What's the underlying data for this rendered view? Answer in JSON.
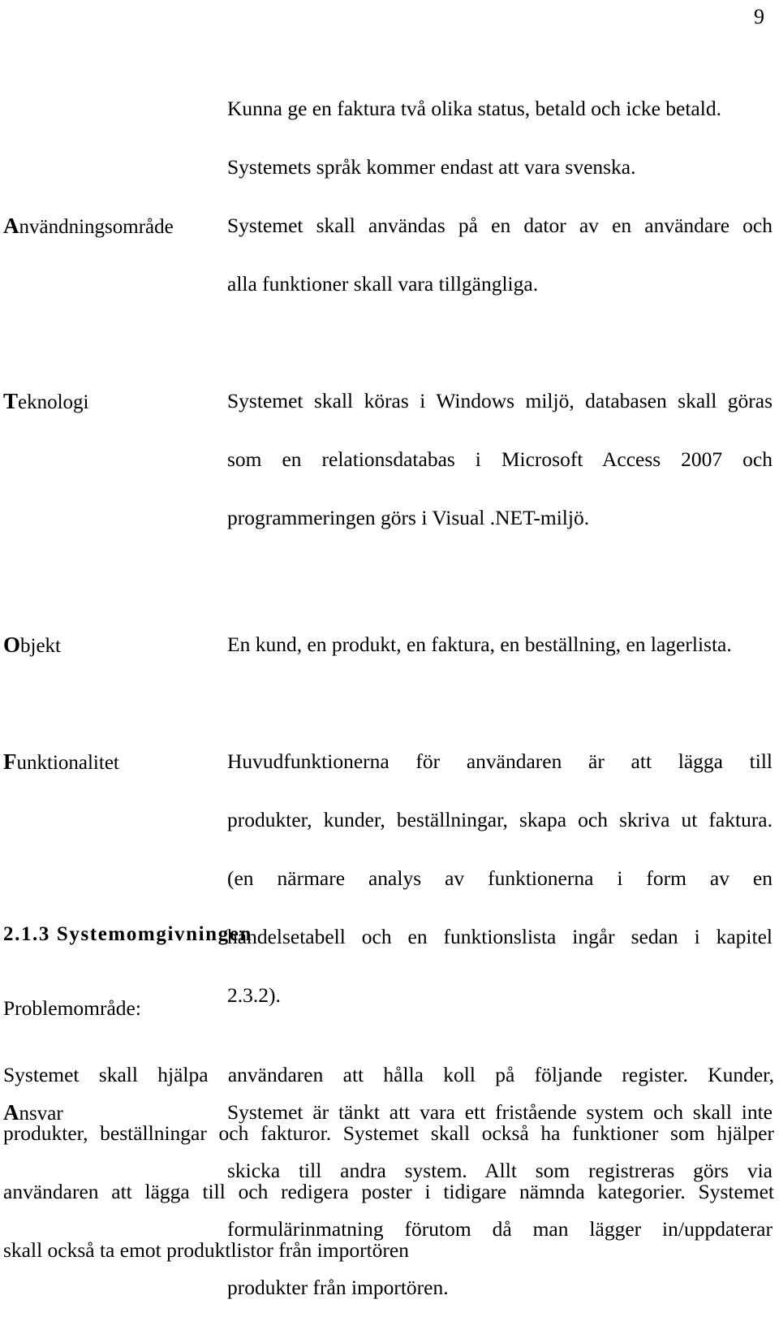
{
  "page": {
    "number": "9"
  },
  "intro": {
    "line1": "Kunna ge en faktura två olika status, betald och icke betald.",
    "line2": "Systemets språk kommer endast att vara svenska."
  },
  "attributes": [
    {
      "label_initial": "A",
      "label_rest": "nvändningsområde",
      "lines": [
        "Systemet skall användas på en dator av en användare och",
        "alla funktioner skall vara tillgängliga."
      ]
    },
    {
      "label_initial": "T",
      "label_rest": "eknologi",
      "lines": [
        "Systemet skall köras i Windows miljö, databasen skall göras",
        "som en relationsdatabas i Microsoft Access 2007 och",
        "programmeringen görs i Visual .NET-miljö."
      ]
    },
    {
      "label_initial": "O",
      "label_rest": "bjekt",
      "lines": [
        "En kund, en produkt, en faktura, en beställning, en lagerlista."
      ]
    },
    {
      "label_initial": "F",
      "label_rest": "unktionalitet",
      "lines": [
        "Huvudfunktionerna för användaren är att lägga till",
        "produkter, kunder, beställningar, skapa och skriva ut faktura.",
        "(en närmare analys av funktionerna i form av en",
        "händelsetabell och en funktionslista ingår sedan i kapitel",
        "2.3.2)."
      ]
    },
    {
      "label_initial": "A",
      "label_rest": "nsvar",
      "lines": [
        "Systemet är tänkt att vara ett fristående system och skall inte",
        "skicka till andra system. Allt som registreras görs via",
        "formulärinmatning förutom då man lägger in/uppdaterar",
        "produkter från importören."
      ]
    }
  ],
  "section": {
    "heading": "2.1.3 Systemomgivningen",
    "subheading": "Problemområde:",
    "paragraph_lines": [
      "Systemet skall hjälpa användaren att hålla koll på följande register. Kunder,",
      "produkter, beställningar och fakturor. Systemet skall också ha funktioner som hjälper",
      "användaren att lägga till och redigera poster i tidigare nämnda kategorier. Systemet",
      "skall också ta emot produktlistor från importören"
    ]
  }
}
